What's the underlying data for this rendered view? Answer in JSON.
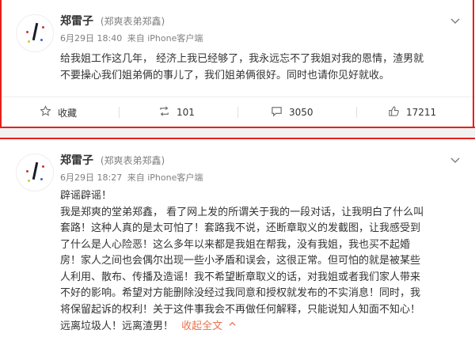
{
  "posts": [
    {
      "author": "郑雷子",
      "tag": "(郑爽表弟郑鑫)",
      "date": "6月29日 18:40",
      "source_prefix": "来自",
      "source": "iPhone客户端",
      "lines": [
        "给我姐工作这几年，  经济上我已经够了，我永远忘不了我姐对我的恩情，渣男就",
        "不要操心我们姐弟俩的事儿了，我们姐弟俩很好。同时也请你见好就收。"
      ],
      "actions": {
        "favorite_label": "收藏",
        "repost_count": "101",
        "comment_count": "3050",
        "like_count": "17211"
      }
    },
    {
      "author": "郑雷子",
      "tag": "(郑爽表弟郑鑫)",
      "date": "6月29日 18:27",
      "source_prefix": "来自",
      "source": "iPhone客户端",
      "lines": [
        "辟谣辟谣！",
        "我是郑爽的堂弟郑鑫，  看了网上发的所谓关于我的一段对话，让我明白了什么叫",
        "套路！这种人真的是太可怕了！套路我不说，还断章取义的发截图，让我感受到",
        "了什么是人心险恶！这么多年以来都是我姐在帮我，没有我姐，我也买不起婚",
        "房！家人之间也会偶尔出现一些小矛盾和误会，这很正常。但可怕的就是被某些",
        "人利用、散布、传播及造谣！我不希望断章取义的话，对我姐或者我们家人带来",
        "不好的影响。希望对方能删除没经过我同意和授权就发布的不实消息！同时，我",
        "将保留起诉的权利！关于这件事我会不再做任何解释，只能说知人知面不知心！"
      ],
      "last_line": "远离垃圾人！远离渣男！",
      "collapse_label": "收起全文"
    }
  ]
}
